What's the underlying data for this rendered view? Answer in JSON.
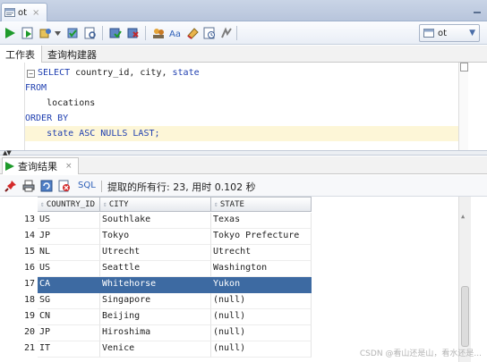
{
  "document_tab": {
    "label": "ot",
    "close": "×"
  },
  "connection": {
    "label": "ot"
  },
  "subtabs": [
    "工作表",
    "查询构建器"
  ],
  "editor": {
    "lines": [
      {
        "tokens": [
          {
            "t": "SELECT",
            "kw": true
          },
          {
            "t": " country_id, city, "
          },
          {
            "t": "state",
            "kw": true
          }
        ],
        "fold": "−"
      },
      {
        "tokens": [
          {
            "t": "FROM",
            "kw": true
          }
        ]
      },
      {
        "tokens": [
          {
            "t": "    locations"
          }
        ]
      },
      {
        "tokens": [
          {
            "t": "ORDER BY",
            "kw": true
          }
        ]
      },
      {
        "tokens": [
          {
            "t": "    state ASC NULLS LAST;",
            "kw": true
          }
        ],
        "current": true
      }
    ]
  },
  "results": {
    "tab_label": "查询结果",
    "tab_close": "×",
    "sql_label": "SQL",
    "status": "提取的所有行: 23, 用时 0.102 秒",
    "columns": [
      "COUNTRY_ID",
      "CITY",
      "STATE"
    ],
    "rows": [
      {
        "n": "13",
        "country_id": "US",
        "city": "Southlake",
        "state": "Texas"
      },
      {
        "n": "14",
        "country_id": "JP",
        "city": "Tokyo",
        "state": "Tokyo Prefecture"
      },
      {
        "n": "15",
        "country_id": "NL",
        "city": "Utrecht",
        "state": "Utrecht"
      },
      {
        "n": "16",
        "country_id": "US",
        "city": "Seattle",
        "state": "Washington"
      },
      {
        "n": "17",
        "country_id": "CA",
        "city": "Whitehorse",
        "state": "Yukon",
        "selected": true
      },
      {
        "n": "18",
        "country_id": "SG",
        "city": "Singapore",
        "state": "(null)"
      },
      {
        "n": "19",
        "country_id": "CN",
        "city": "Beijing",
        "state": "(null)"
      },
      {
        "n": "20",
        "country_id": "JP",
        "city": "Hiroshima",
        "state": "(null)"
      },
      {
        "n": "21",
        "country_id": "IT",
        "city": "Venice",
        "state": "(null)"
      }
    ]
  },
  "watermark": "CSDN @看山还是山，看水还是...",
  "colors": {
    "selection": "#3d6aa2",
    "keyword": "#1f3fb0",
    "run": "#1e9a2b"
  }
}
